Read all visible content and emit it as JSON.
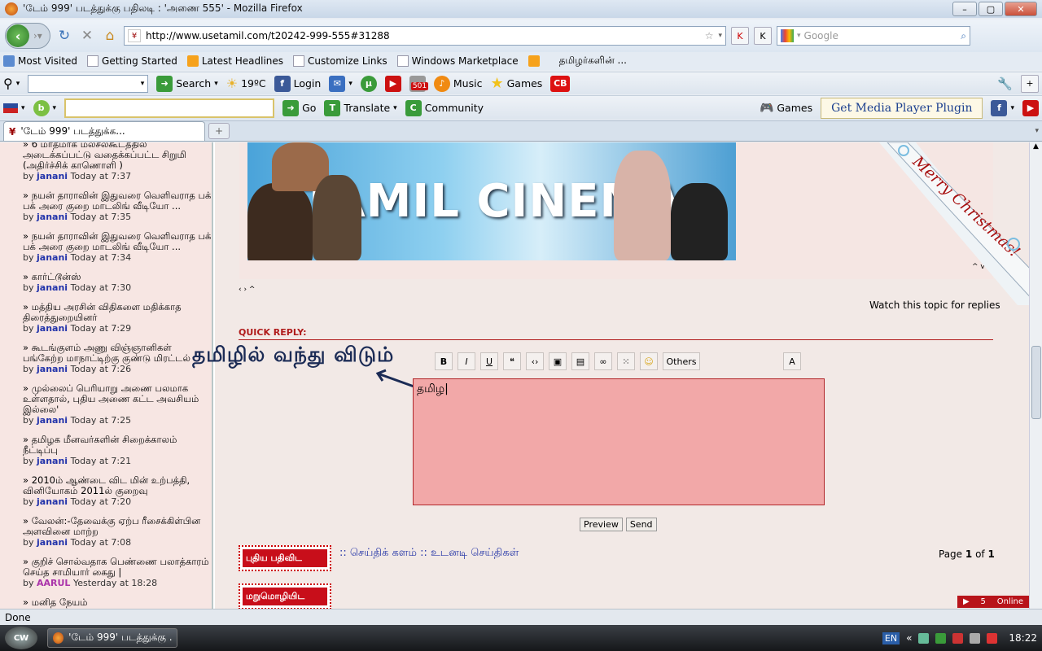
{
  "window": {
    "title": "'டேம் 999' படத்துக்கு பதிலடி : 'அணை 555' - Mozilla Firefox"
  },
  "nav": {
    "url": "http://www.usetamil.com/t20242-999-555#31288",
    "search_placeholder": "Google"
  },
  "bookmarks": [
    "Most Visited",
    "Getting Started",
    "Latest Headlines",
    "Customize Links",
    "Windows Marketplace",
    "தமிழர்களின் ..."
  ],
  "toolbar1": {
    "search": "Search",
    "weather": "19ºC",
    "login": "Login",
    "badge": "501",
    "music": "Music",
    "games": "Games",
    "cb": "CB"
  },
  "toolbar2": {
    "go": "Go",
    "translate": "Translate",
    "community": "Community",
    "games": "Games",
    "media_plugin": "Get Media Player Plugin"
  },
  "tab": {
    "title": "'டேம் 999' படத்துக்க..."
  },
  "sidebar": {
    "entries": [
      {
        "title": "» 6 மாதமாக மலசலகூடத்தில அடைக்கப்பட்டு வதைக்கப்பட்ட சிறுமி (அதிர்ச்சிக் காணொளி )",
        "by": "by",
        "user": "janani",
        "time": "Today at 7:37"
      },
      {
        "title": "» நயன் தாராவின் இதுவரை வெளிவராத பக் பக் அரை குறை மாடலிங் வீடியோ ...",
        "by": "by",
        "user": "janani",
        "time": "Today at 7:35"
      },
      {
        "title": "» நயன் தாராவின் இதுவரை வெளிவராத பக் பக் அரை குறை மாடலிங் வீடியோ ...",
        "by": "by",
        "user": "janani",
        "time": "Today at 7:34"
      },
      {
        "title": "» கார்ட்டூன்ஸ்",
        "by": "by",
        "user": "janani",
        "time": "Today at 7:30"
      },
      {
        "title": "» மத்திய அரசின் விதிகளை மதிக்காத திரைத்துறையினர்",
        "by": "by",
        "user": "janani",
        "time": "Today at 7:29"
      },
      {
        "title": "» கூடங்குளம் அணு விஞ்ஞானிகள் பங்கேற்ற மாநாட்டிற்கு குண்டு மிரட்டல்",
        "by": "by",
        "user": "janani",
        "time": "Today at 7:26"
      },
      {
        "title": "» முல்லைப் பெரியாறு அணை பலமாக உள்ளதால், புதிய அணை கட்ட அவசியம் இல்லை'",
        "by": "by",
        "user": "janani",
        "time": "Today at 7:25"
      },
      {
        "title": "» தமிழக மீனவர்களின் சிறைக்காலம் நீட்டிப்பு",
        "by": "by",
        "user": "janani",
        "time": "Today at 7:21"
      },
      {
        "title": "» 2010ம் ஆண்டை விட மின் உற்பத்தி, வினியோகம் 2011ல் குறைவு",
        "by": "by",
        "user": "janani",
        "time": "Today at 7:20"
      },
      {
        "title": "» வேலன்:-தேவைக்கு ஏற்ப ரீசைக்கிள்பின அளவினை மாற்ற",
        "by": "by",
        "user": "janani",
        "time": "Today at 7:08"
      },
      {
        "title": "» குறிச் சொல்வதாக பெண்ணை பலாத்காரம் செய்த சாமியார் கைது |",
        "by": "by",
        "user": "AARUL",
        "time": "Yesterday at 18:28"
      },
      {
        "title": "» மனித நேயம்",
        "by": "",
        "user": "",
        "time": ""
      }
    ]
  },
  "main": {
    "banner_text": "TAMIL CINEMA",
    "xmas_text": "Merry Christmas!",
    "watch_label": "Watch this topic for replies",
    "quick_reply": "QUICK REPLY:",
    "overlay_text": "தமிழில் வந்து விடும்",
    "others_label": "Others",
    "editor_text": "தமிழ",
    "preview_label": "Preview",
    "send_label": "Send",
    "new_post_label": "புதிய பதிவிட",
    "reply_label": "மறுமொழியிட",
    "breadcrumb": ":: செய்திக் களம் :: உடனடி செய்திகள்",
    "page_prefix": "Page",
    "page_current": "1",
    "page_of": "of",
    "page_total": "1",
    "online_count": "5",
    "online_label": "Online"
  },
  "status": {
    "text": "Done"
  },
  "taskbar": {
    "task": "'டேம் 999' படத்துக்கு ...",
    "lang": "EN",
    "clock": "18:22",
    "orb": "CW"
  }
}
